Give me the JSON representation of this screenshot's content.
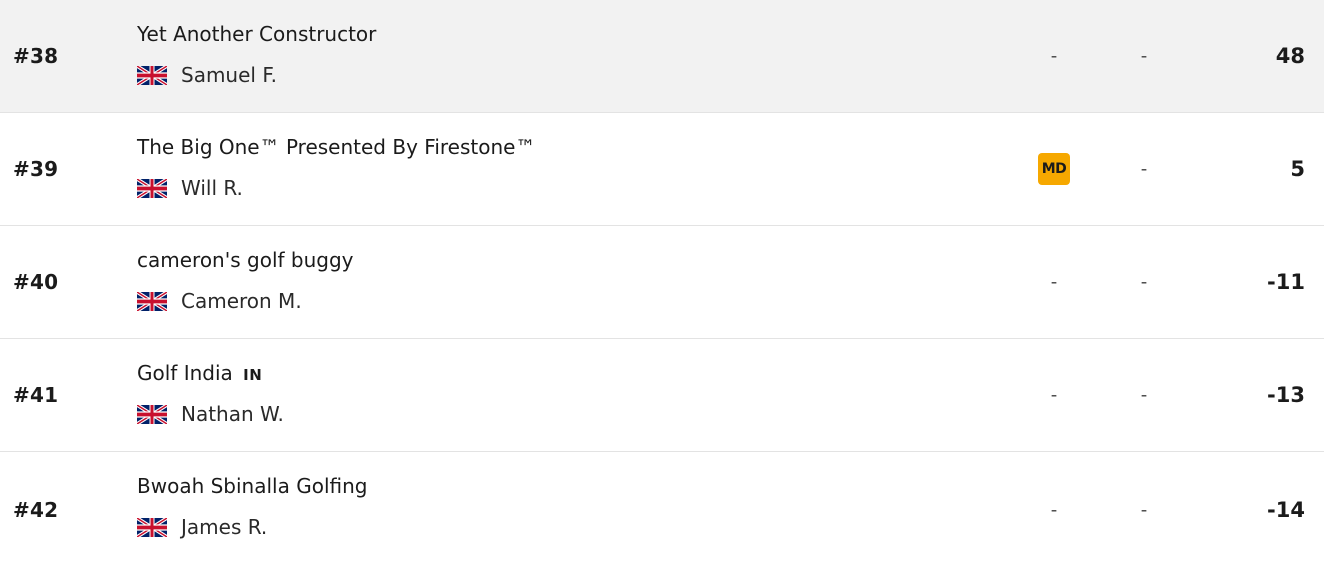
{
  "leaderboard": {
    "rows": [
      {
        "rank": "#38",
        "team": "Yet Another Constructor",
        "tag": "",
        "manager": "Samuel F.",
        "flag": "uk-flag-icon",
        "chip": "-",
        "chip_badge": "",
        "transfers": "-",
        "points": "48",
        "highlight": true
      },
      {
        "rank": "#39",
        "team": "The Big One™ Presented By Firestone™",
        "tag": "",
        "manager": "Will R.",
        "flag": "uk-flag-icon",
        "chip": "",
        "chip_badge": "MD",
        "transfers": "-",
        "points": "5",
        "highlight": false
      },
      {
        "rank": "#40",
        "team": "cameron's golf buggy",
        "tag": "",
        "manager": "Cameron M.",
        "flag": "uk-flag-icon",
        "chip": "-",
        "chip_badge": "",
        "transfers": "-",
        "points": "-11",
        "highlight": false
      },
      {
        "rank": "#41",
        "team": "Golf India",
        "tag": "IN",
        "manager": "Nathan W.",
        "flag": "uk-flag-icon",
        "chip": "-",
        "chip_badge": "",
        "transfers": "-",
        "points": "-13",
        "highlight": false
      },
      {
        "rank": "#42",
        "team": "Bwoah Sbinalla Golfing",
        "tag": "",
        "manager": "James R.",
        "flag": "uk-flag-icon",
        "chip": "-",
        "chip_badge": "",
        "transfers": "-",
        "points": "-14",
        "highlight": false
      }
    ]
  },
  "colors": {
    "highlight_row": "#f2f2f2",
    "chip_badge": "#f6a800",
    "flag_blue": "#012169",
    "flag_red": "#C8102E"
  }
}
